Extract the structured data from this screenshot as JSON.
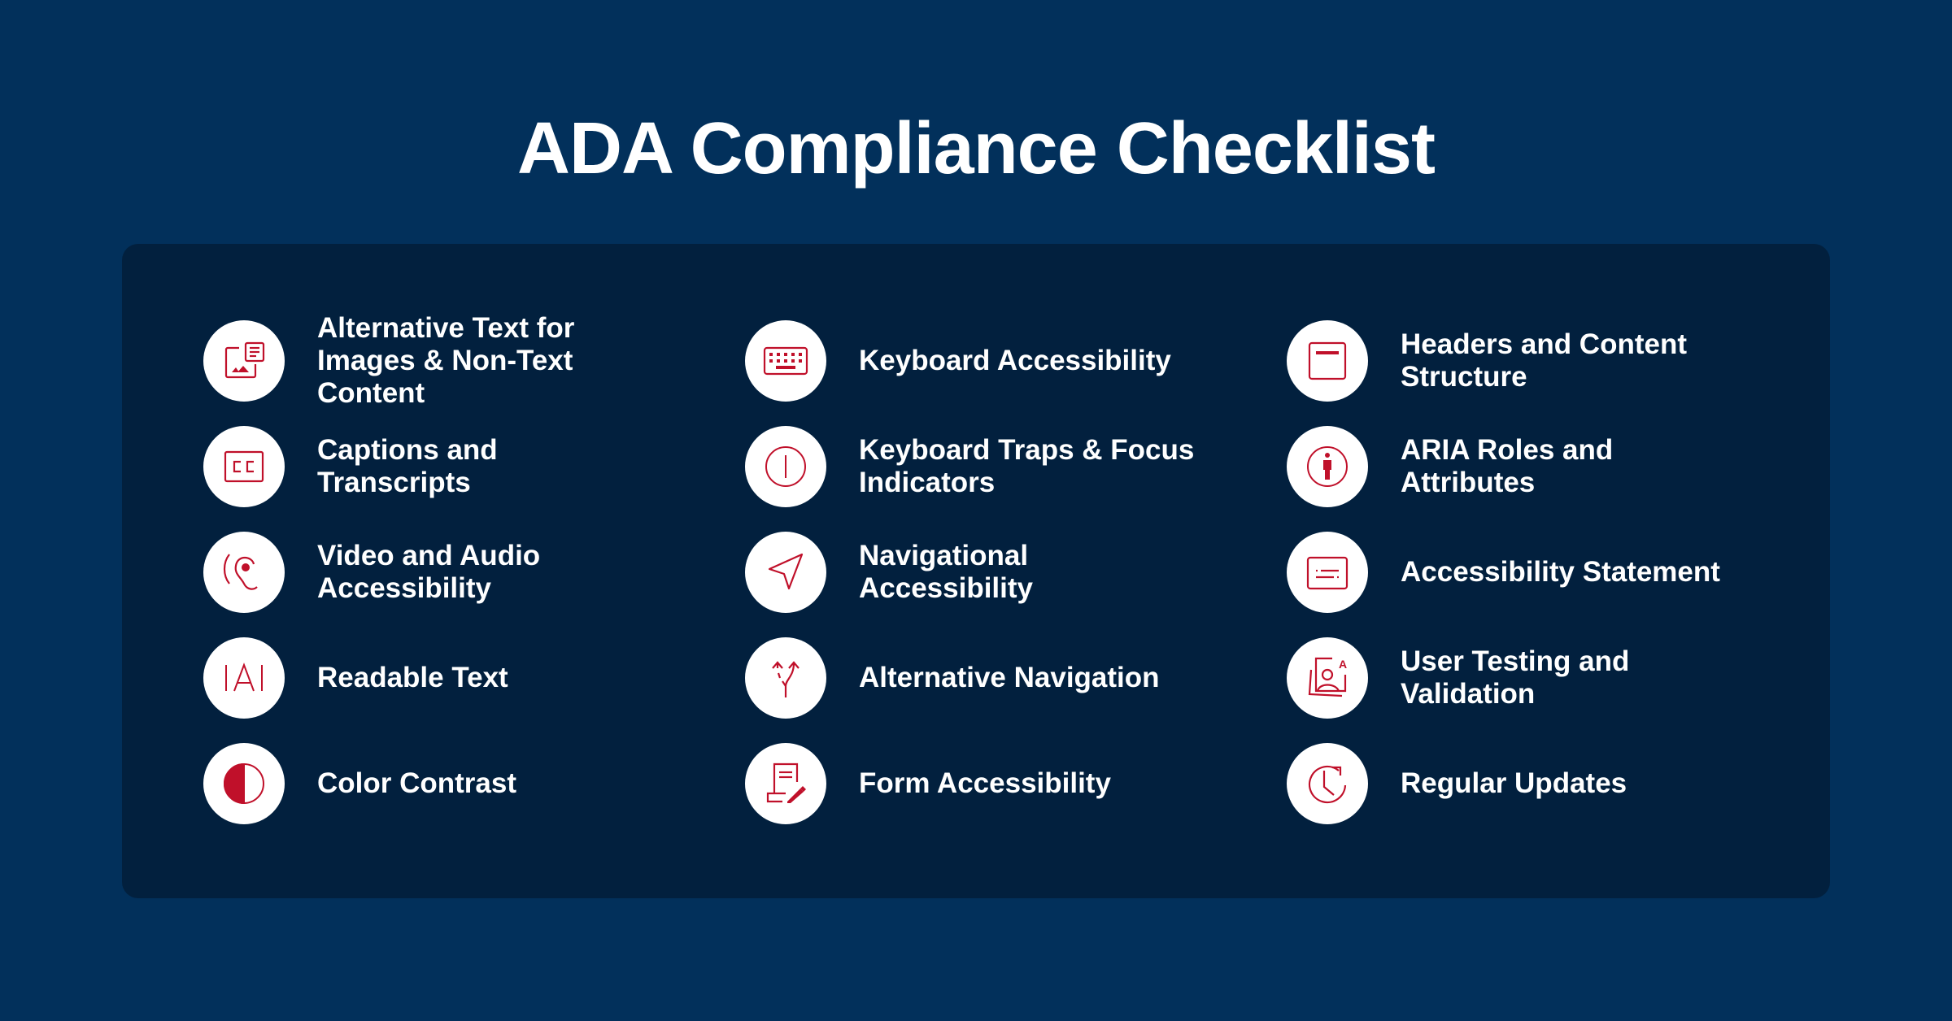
{
  "title": "ADA Compliance Checklist",
  "colors": {
    "background": "#02305b",
    "panel": "#02203e",
    "icon_accent": "#c0102a",
    "text": "#ffffff"
  },
  "columns": [
    {
      "items": [
        {
          "label": "Alternative Text for\nImages & Non-Text\nContent",
          "icon": "image-with-text-icon"
        },
        {
          "label": "Captions and\nTranscripts",
          "icon": "closed-captions-icon"
        },
        {
          "label": "Video and Audio\nAccessibility",
          "icon": "hearing-ear-icon"
        },
        {
          "label": "Readable Text",
          "icon": "text-cursor-icon"
        },
        {
          "label": "Color Contrast",
          "icon": "contrast-icon"
        }
      ]
    },
    {
      "items": [
        {
          "label": "Keyboard Accessibility",
          "icon": "keyboard-icon"
        },
        {
          "label": "Keyboard Traps & Focus\nIndicators",
          "icon": "focus-ring-icon"
        },
        {
          "label": "Navigational\nAccessibility",
          "icon": "navigation-arrow-icon"
        },
        {
          "label": "Alternative Navigation",
          "icon": "split-path-icon"
        },
        {
          "label": "Form Accessibility",
          "icon": "form-edit-icon"
        }
      ]
    },
    {
      "items": [
        {
          "label": "Headers and Content\nStructure",
          "icon": "header-block-icon"
        },
        {
          "label": "ARIA Roles and\nAttributes",
          "icon": "accessibility-person-icon"
        },
        {
          "label": "Accessibility Statement",
          "icon": "statement-card-icon"
        },
        {
          "label": "User Testing and\nValidation",
          "icon": "user-testing-icon"
        },
        {
          "label": "Regular Updates",
          "icon": "clock-refresh-icon"
        }
      ]
    }
  ]
}
